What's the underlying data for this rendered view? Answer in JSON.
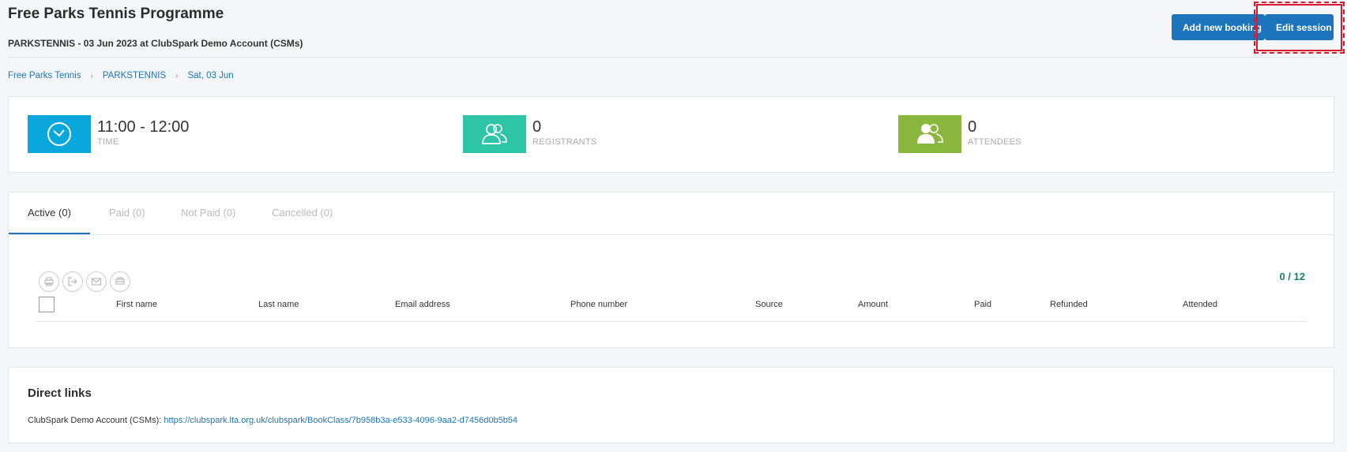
{
  "header": {
    "title": "Free Parks Tennis Programme",
    "subtitle": "PARKSTENNIS - 03 Jun 2023 at ClubSpark Demo Account (CSMs)",
    "add_booking_label": "Add new booking",
    "edit_session_label": "Edit session"
  },
  "breadcrumb": {
    "items": [
      "Free Parks Tennis",
      "PARKSTENNIS",
      "Sat, 03 Jun"
    ],
    "separator": "›"
  },
  "stats": [
    {
      "value": "11:00 - 12:00",
      "label": "TIME",
      "icon": "clock-icon",
      "color": "#0aa7dd"
    },
    {
      "value": "0",
      "label": "REGISTRANTS",
      "icon": "users-icon",
      "color": "#2ec4a6"
    },
    {
      "value": "0",
      "label": "ATTENDEES",
      "icon": "user-check-icon",
      "color": "#8ab83f"
    }
  ],
  "tabs": [
    {
      "label": "Active (0)",
      "active": true
    },
    {
      "label": "Paid (0)",
      "active": false
    },
    {
      "label": "Not Paid (0)",
      "active": false
    },
    {
      "label": "Cancelled (0)",
      "active": false
    }
  ],
  "table": {
    "count": "0 / 12",
    "columns": [
      "First name",
      "Last name",
      "Email address",
      "Phone number",
      "Source",
      "Amount",
      "Paid",
      "Refunded",
      "Attended"
    ],
    "toolbar_icons": [
      "print-icon",
      "export-icon",
      "email-icon",
      "printer-icon"
    ]
  },
  "direct_links": {
    "title": "Direct links",
    "account_label": "ClubSpark Demo Account (CSMs):",
    "url": "https://clubspark.lta.org.uk/clubspark/BookClass/7b958b3a-e533-4096-9aa2-d7456d0b5b54"
  },
  "colors": {
    "primary": "#1c75bc",
    "highlight": "#d8182b",
    "count": "#1a7f6a"
  }
}
